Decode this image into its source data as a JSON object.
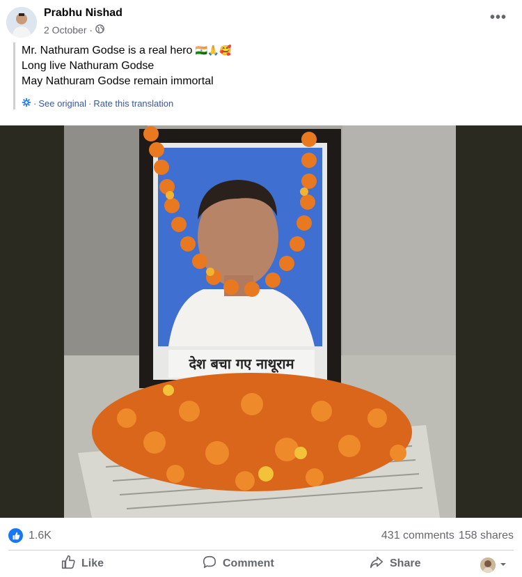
{
  "post": {
    "author": "Prabhu Nishad",
    "date": "2 October ·",
    "more_label": "•••",
    "translated_lines": [
      "Mr. Nathuram Godse is a real hero",
      "Long live Nathuram Godse",
      "May Nathuram Godse remain immortal"
    ],
    "emojis": "🇮🇳🙏🥰",
    "see_original": "See original",
    "separator": "·",
    "rate_translation": "Rate this translation",
    "photo_caption": "देश बचा गए नाथूराम"
  },
  "stats": {
    "likes": "1.6K",
    "comments": "431 comments",
    "shares": "158 shares"
  },
  "actions": {
    "like": "Like",
    "comment": "Comment",
    "share": "Share"
  },
  "icons": [
    "globe-icon",
    "more-icon",
    "gear-icon",
    "like-icon",
    "comment-icon",
    "share-icon",
    "chevron-down-icon"
  ],
  "colors": {
    "link": "#385898",
    "like": "#1877f2",
    "secondary": "#65676b"
  }
}
